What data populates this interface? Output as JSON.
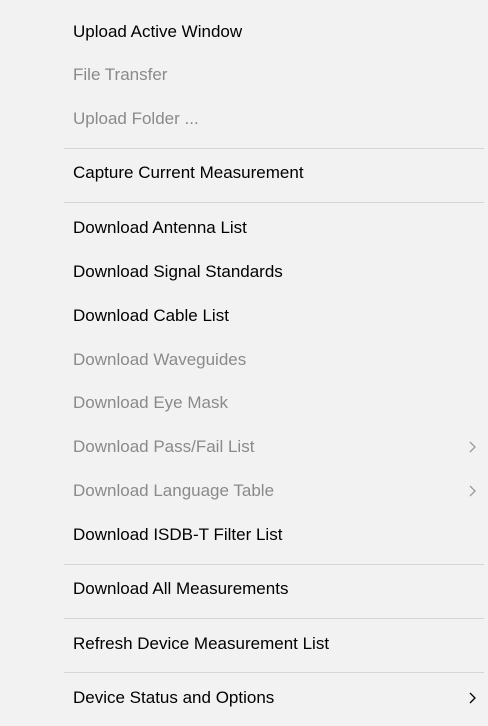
{
  "menu": {
    "items": [
      {
        "label": "Upload Active Window",
        "enabled": true
      },
      {
        "label": "File Transfer",
        "enabled": false
      },
      {
        "label": "Upload Folder ...",
        "enabled": false
      },
      {
        "label": "Capture Current Measurement",
        "enabled": true
      },
      {
        "label": "Download Antenna List",
        "enabled": true
      },
      {
        "label": "Download Signal Standards",
        "enabled": true
      },
      {
        "label": "Download Cable List",
        "enabled": true
      },
      {
        "label": "Download Waveguides",
        "enabled": false
      },
      {
        "label": "Download Eye Mask",
        "enabled": false
      },
      {
        "label": "Download Pass/Fail List",
        "enabled": false,
        "submenu_icon": "chevron-right-icon"
      },
      {
        "label": "Download Language Table",
        "enabled": false,
        "submenu_icon": "chevron-right-icon"
      },
      {
        "label": "Download ISDB-T Filter List",
        "enabled": true
      },
      {
        "label": "Download All Measurements",
        "enabled": true
      },
      {
        "label": "Refresh Device Measurement List",
        "enabled": true
      },
      {
        "label": "Device Status and Options",
        "enabled": true,
        "submenu_icon": "chevron-right-icon"
      }
    ]
  },
  "colors": {
    "background": "#f2f2f2",
    "text_enabled": "#000000",
    "text_disabled": "#8a8a8a",
    "separator": "#d6d6d6",
    "arrow_enabled": "#000000",
    "arrow_disabled": "#9a9a9a"
  }
}
